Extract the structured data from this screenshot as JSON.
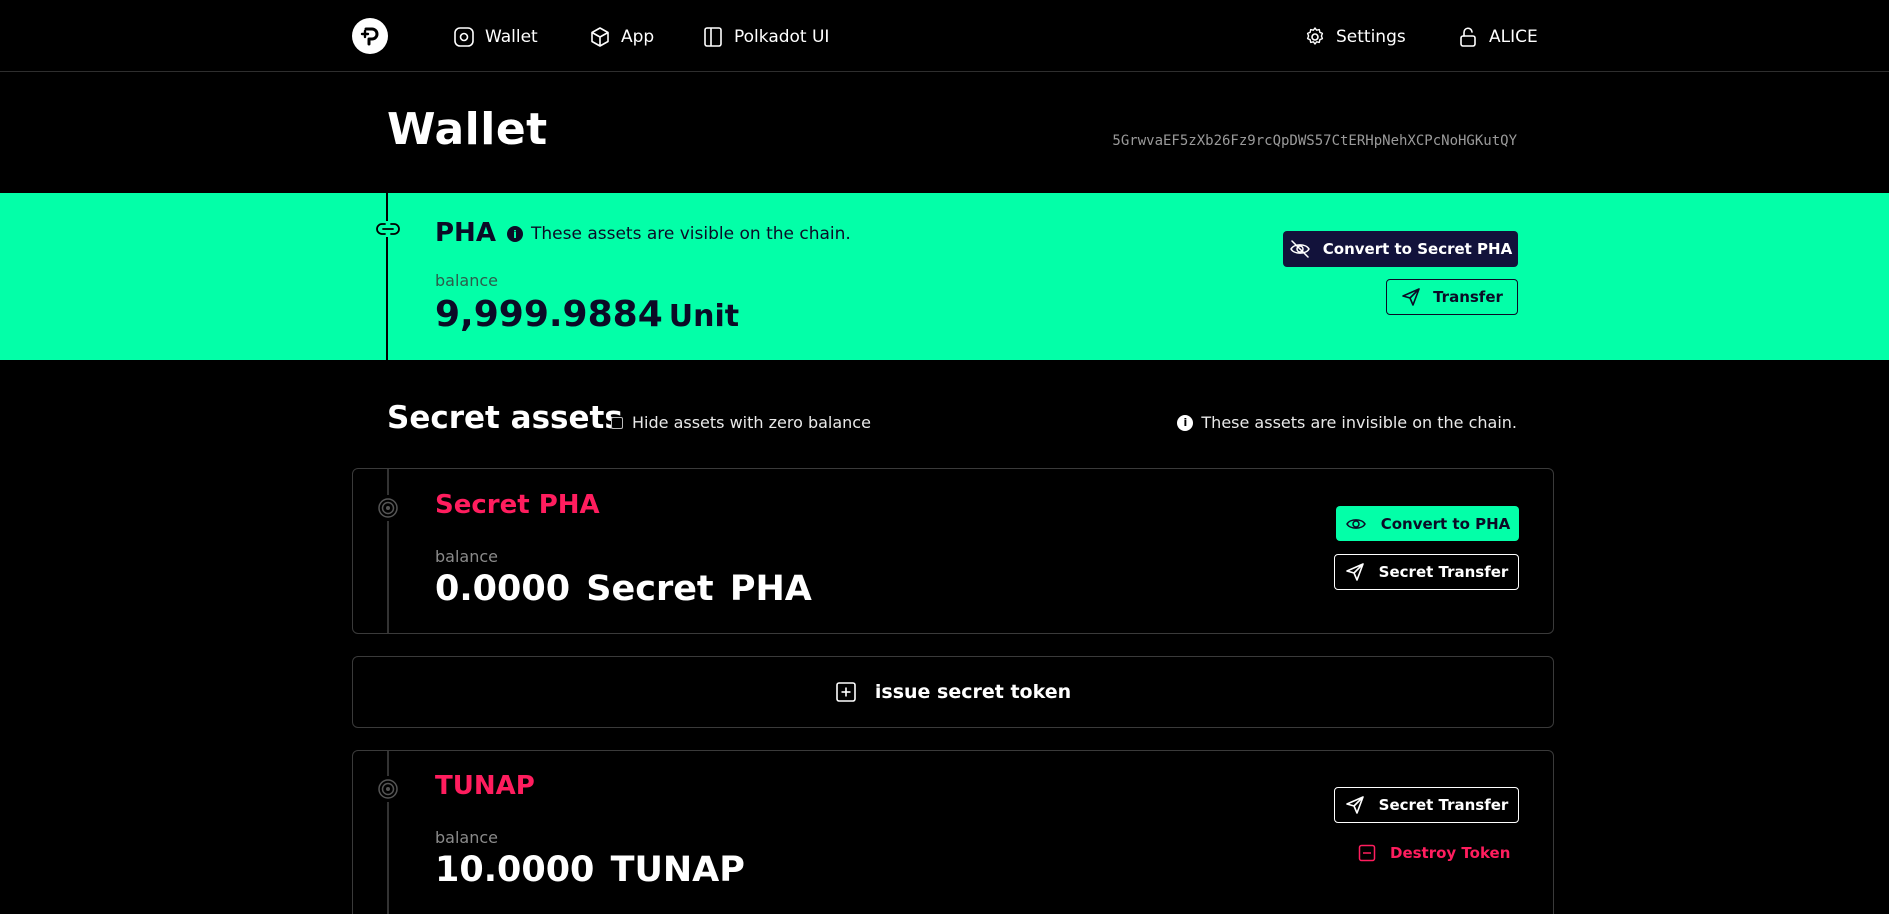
{
  "nav": {
    "items": [
      {
        "label": "Wallet",
        "icon": "wallet-icon"
      },
      {
        "label": "App",
        "icon": "cube-icon"
      },
      {
        "label": "Polkadot UI",
        "icon": "sidebar-icon"
      }
    ],
    "settings_label": "Settings",
    "account_label": "ALICE"
  },
  "header": {
    "title": "Wallet",
    "address": "5GrwvaEF5zXb26Fz9rcQpDWS57CtERHpNehXCPcNoHGKutQY"
  },
  "pha": {
    "title": "PHA",
    "note": "These assets are visible on the chain.",
    "balance_label": "balance",
    "balance": "9,999.9884",
    "unit": "Unit",
    "convert_label": "Convert to Secret PHA",
    "transfer_label": "Transfer"
  },
  "secret": {
    "title": "Secret assets",
    "hide_zero_label": "Hide assets with zero balance",
    "note": "These assets are invisible on the chain.",
    "issue_label": "issue secret token",
    "assets": [
      {
        "title": "Secret PHA",
        "balance_label": "balance",
        "balance": "0.0000  Secret PHA",
        "convert_label": "Convert to PHA",
        "transfer_label": "Secret Transfer"
      },
      {
        "title": "TUNAP",
        "balance_label": "balance",
        "balance": "10.0000  TUNAP",
        "transfer_label": "Secret Transfer",
        "destroy_label": "Destroy Token"
      }
    ]
  },
  "colors": {
    "accent_green": "#03ffa8",
    "navy": "#12123b",
    "token_red": "#ff1d5e",
    "background": "#000000"
  }
}
